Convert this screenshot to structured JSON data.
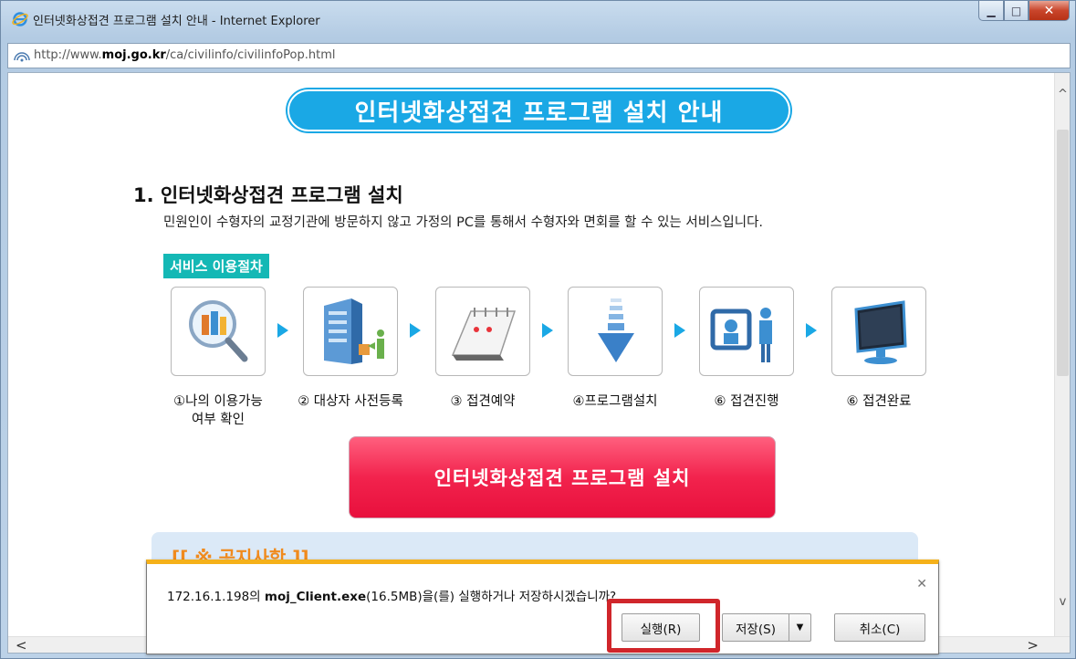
{
  "window": {
    "title": "인터넷화상접견 프로그램 설치 안내 - Internet Explorer",
    "url_prefix": "http://www.",
    "url_domain": "moj.go.kr",
    "url_path": "/ca/civilinfo/civilinfoPop.html"
  },
  "page": {
    "banner": "인터넷화상접견 프로그램 설치 안내",
    "section_title": "1. 인터넷화상접견 프로그램 설치",
    "section_desc": "민원인이 수형자의 교정기관에 방문하지 않고 가정의 PC를 통해서 수형자와 면회를 할 수 있는 서비스입니다.",
    "service_label": "서비스 이용절차",
    "steps": [
      {
        "label": "①나의 이용가능",
        "label2": "여부 확인"
      },
      {
        "label": "② 대상자 사전등록",
        "label2": ""
      },
      {
        "label": "③ 접견예약",
        "label2": ""
      },
      {
        "label": "④프로그램설치",
        "label2": ""
      },
      {
        "label": "⑥ 접견진행",
        "label2": ""
      },
      {
        "label": "⑥ 접견완료",
        "label2": ""
      }
    ],
    "install_button": "인터넷화상접견 프로그램 설치",
    "notice_title": "[[ ※ 공지사항 ]]"
  },
  "download_bar": {
    "source": "172.16.1.198의 ",
    "filename": "moj_Client.exe",
    "message_rest": "(16.5MB)을(를) 실행하거나 저장하시겠습니까?",
    "run": "실행(R)",
    "save": "저장(S)",
    "cancel": "취소(C)"
  },
  "colors": {
    "banner": "#1aa8e5",
    "install_button": "#f2234d",
    "highlight": "#d0262b",
    "notify_border": "#f5b11a"
  }
}
